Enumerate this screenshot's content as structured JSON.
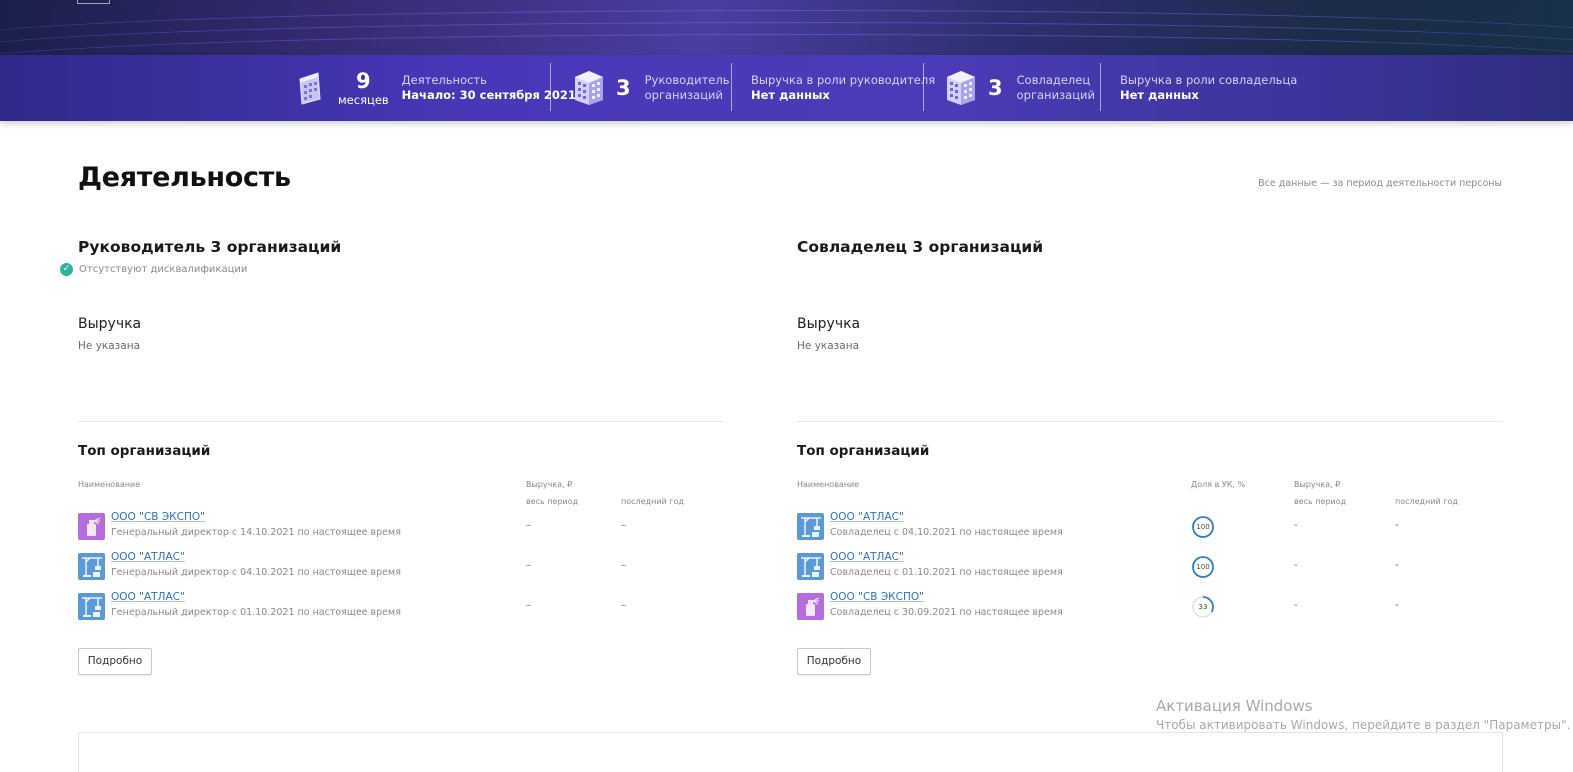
{
  "stats": {
    "months_num": "9",
    "months_label": "месяцев",
    "activity_label": "Деятельность",
    "activity_start": "Начало: 30 сентября 2021",
    "head_count": "3",
    "head_label_1": "Руководитель",
    "head_label_2": "организаций",
    "head_rev_label": "Выручка в роли руководителя",
    "head_rev_value": "Нет данных",
    "owner_count": "3",
    "owner_label_1": "Совладелец",
    "owner_label_2": "организаций",
    "owner_rev_label": "Выручка в роли совладельца",
    "owner_rev_value": "Нет данных"
  },
  "page": {
    "title": "Деятельность",
    "note": "Все данные — за период деятельности персоны"
  },
  "left": {
    "title": "Руководитель 3 организаций",
    "disq": "Отсутствуют дисквалификации",
    "revenue_label": "Выручка",
    "revenue_value": "Не указана",
    "top_title": "Топ организаций",
    "col_name": "Наименование",
    "col_revenue": "Выручка, ₽",
    "col_period": "весь период",
    "col_lastyear": "последний год",
    "rows": [
      {
        "name": "ООО \"СВ ЭКСПО\"",
        "role": "Генеральный директор с 14.10.2021 по настоящее время",
        "period": "–",
        "last": "–",
        "icon": "purple"
      },
      {
        "name": "ООО \"АТЛАС\"",
        "role": "Генеральный директор с 04.10.2021 по настоящее время",
        "period": "–",
        "last": "–",
        "icon": "blue"
      },
      {
        "name": "ООО \"АТЛАС\"",
        "role": "Генеральный директор с 01.10.2021 по настоящее время",
        "period": "–",
        "last": "–",
        "icon": "blue"
      }
    ],
    "button": "Подробно"
  },
  "right": {
    "title": "Совладелец 3 организаций",
    "revenue_label": "Выручка",
    "revenue_value": "Не указана",
    "top_title": "Топ организаций",
    "col_name": "Наименование",
    "col_share": "Доля в УК, %",
    "col_revenue": "Выручка, ₽",
    "col_period": "весь период",
    "col_lastyear": "последний год",
    "rows": [
      {
        "name": "ООО \"АТЛАС\"",
        "role": "Совладелец с 04.10.2021 по настоящее время",
        "share": "100",
        "share_fraction": 1.0,
        "period": "-",
        "last": "-",
        "icon": "blue"
      },
      {
        "name": "ООО \"АТЛАС\"",
        "role": "Совладелец с 01.10.2021 по настоящее время",
        "share": "100",
        "share_fraction": 1.0,
        "period": "-",
        "last": "-",
        "icon": "blue"
      },
      {
        "name": "ООО \"СВ ЭКСПО\"",
        "role": "Совладелец с 30.09.2021 по настоящее время",
        "share": "33",
        "share_fraction": 0.33,
        "period": "-",
        "last": "-",
        "icon": "purple"
      }
    ],
    "button": "Подробно"
  },
  "watermark": {
    "title": "Активация Windows",
    "text": "Чтобы активировать Windows, перейдите в раздел \"Параметры\"."
  },
  "colors": {
    "link": "#2f6fc0",
    "accent_check": "#2fb3a0",
    "share_ring": "#2f7fc8",
    "icon_purple": "#b66bde",
    "icon_blue": "#5b9ad6"
  }
}
